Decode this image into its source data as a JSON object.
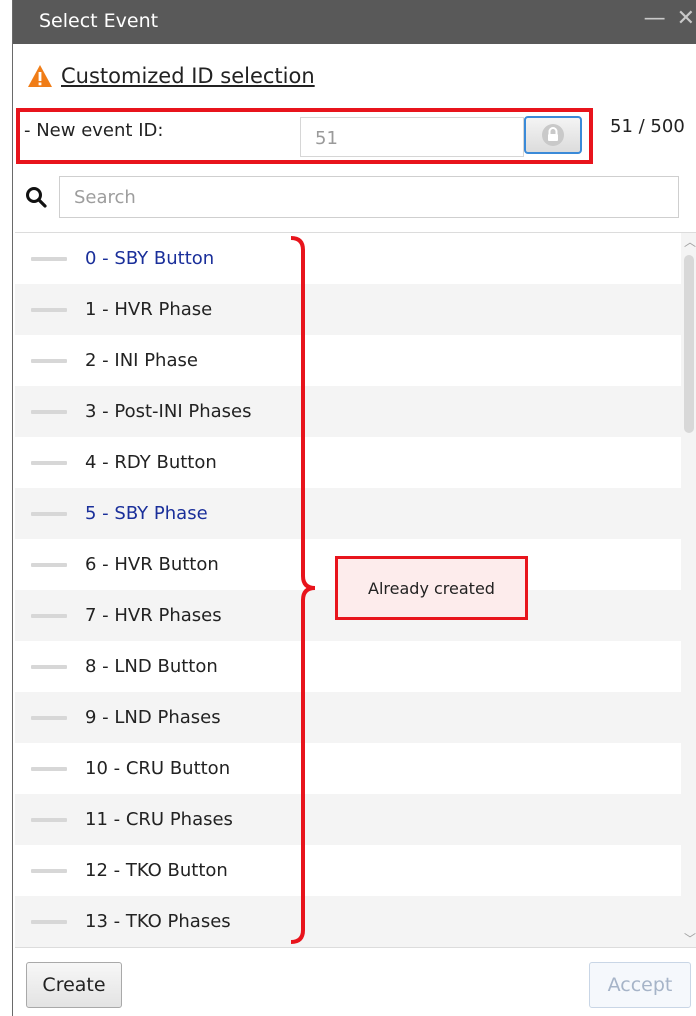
{
  "window": {
    "title": "Select Event",
    "minimize_glyph": "—",
    "close_glyph": "✕"
  },
  "warning": {
    "icon": "warning-icon",
    "link_text": "Customized ID selection"
  },
  "event_id": {
    "label": "- New event ID:",
    "value": "51",
    "lock_icon": "lock-icon",
    "counter": "51 / 500"
  },
  "search": {
    "icon": "search-icon",
    "placeholder": "Search"
  },
  "events": [
    {
      "label": "0 - SBY Button",
      "highlight": true
    },
    {
      "label": "1 - HVR Phase",
      "highlight": false
    },
    {
      "label": "2 - INI Phase",
      "highlight": false
    },
    {
      "label": "3 - Post-INI Phases",
      "highlight": false
    },
    {
      "label": "4 - RDY Button",
      "highlight": false
    },
    {
      "label": "5 - SBY Phase",
      "highlight": true
    },
    {
      "label": "6 - HVR Button",
      "highlight": false
    },
    {
      "label": "7 - HVR Phases",
      "highlight": false
    },
    {
      "label": "8 - LND Button",
      "highlight": false
    },
    {
      "label": "9 - LND Phases",
      "highlight": false
    },
    {
      "label": "10 - CRU Button",
      "highlight": false
    },
    {
      "label": "11 - CRU Phases",
      "highlight": false
    },
    {
      "label": "12 - TKO Button",
      "highlight": false
    },
    {
      "label": "13 - TKO Phases",
      "highlight": false
    }
  ],
  "annotation": {
    "callout_text": "Already created",
    "accent_color": "#e8141c"
  },
  "footer": {
    "create_label": "Create",
    "accept_label": "Accept"
  },
  "colors": {
    "titlebar": "#595959",
    "highlight_text": "#1a2f9a",
    "warning": "#f07d17"
  }
}
